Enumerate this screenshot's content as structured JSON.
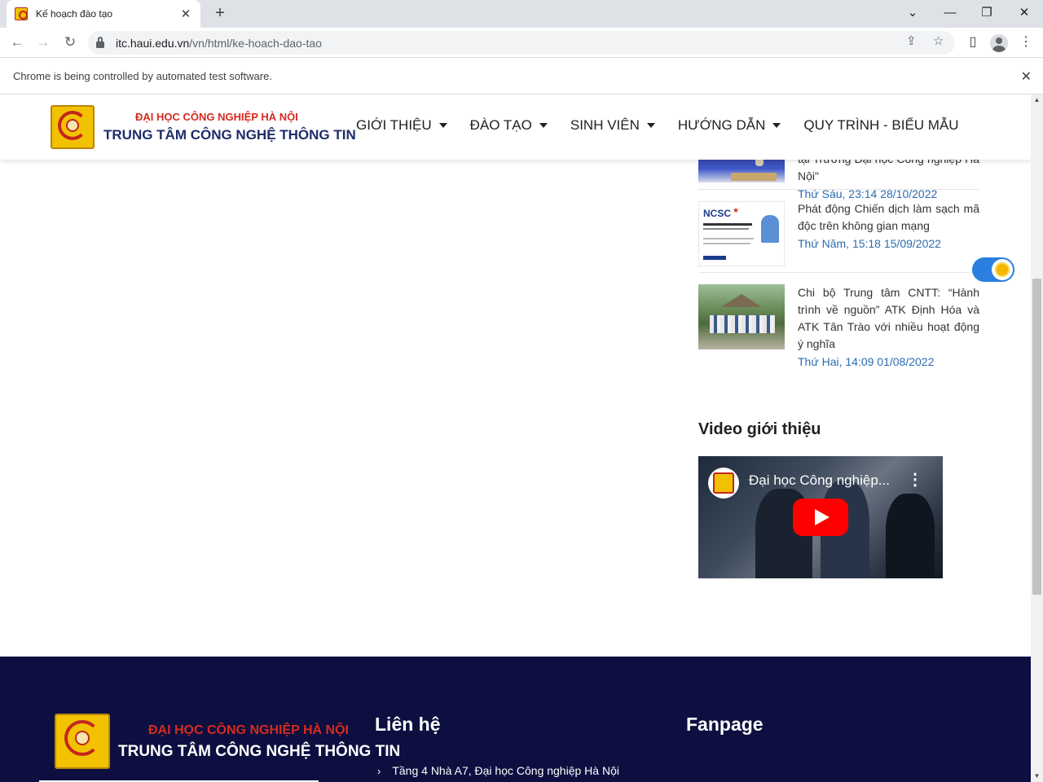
{
  "browser": {
    "tab_title": "Kế hoạch đào tạo",
    "url_host": "itc.haui.edu.vn",
    "url_path": "/vn/html/ke-hoach-dao-tao",
    "infobar_text": "Chrome is being controlled by automated test software."
  },
  "site": {
    "logo_line1": "ĐẠI HỌC CÔNG NGHIỆP HÀ NỘI",
    "logo_line2": "TRUNG TÂM CÔNG NGHỆ THÔNG TIN",
    "menu": [
      {
        "label": "GIỚI THIỆU",
        "has_dropdown": true
      },
      {
        "label": "ĐÀO TẠO",
        "has_dropdown": true
      },
      {
        "label": "SINH VIÊN",
        "has_dropdown": true
      },
      {
        "label": "HƯỚNG DẪN",
        "has_dropdown": true
      },
      {
        "label": "QUY TRÌNH - BIỂU MẪU",
        "has_dropdown": false
      }
    ]
  },
  "news": [
    {
      "title": "số giải pháp thúc đẩy chuyển đổi số tại Trường Đại học Công nghiệp Hà Nội\"",
      "date": "Thứ Sáu, 23:14 28/10/2022"
    },
    {
      "title": "Phát động Chiến dịch làm sạch mã độc trên không gian mạng",
      "date": "Thứ Năm, 15:18 15/09/2022",
      "thumb_text": "NCSC"
    },
    {
      "title": "Chi bộ Trung tâm CNTT: “Hành trình về nguồn” ATK Định Hóa và ATK Tân Trào với nhiều hoạt động ý nghĩa",
      "date": "Thứ Hai, 14:09 01/08/2022"
    }
  ],
  "video_section": {
    "heading": "Video giới thiệu",
    "video_title": "Đại học Công nghiệp..."
  },
  "footer": {
    "contact_heading": "Liên hệ",
    "fanpage_heading": "Fanpage",
    "address": "Tầng 4 Nhà A7, Đại học Công nghiệp Hà Nội"
  },
  "colors": {
    "footer_bg": "#0c0f3f",
    "date_blue": "#2b6cb0",
    "logo_red": "#d62b1e",
    "logo_navy": "#1f2d6b",
    "toggle_blue": "#2a7fe0"
  }
}
